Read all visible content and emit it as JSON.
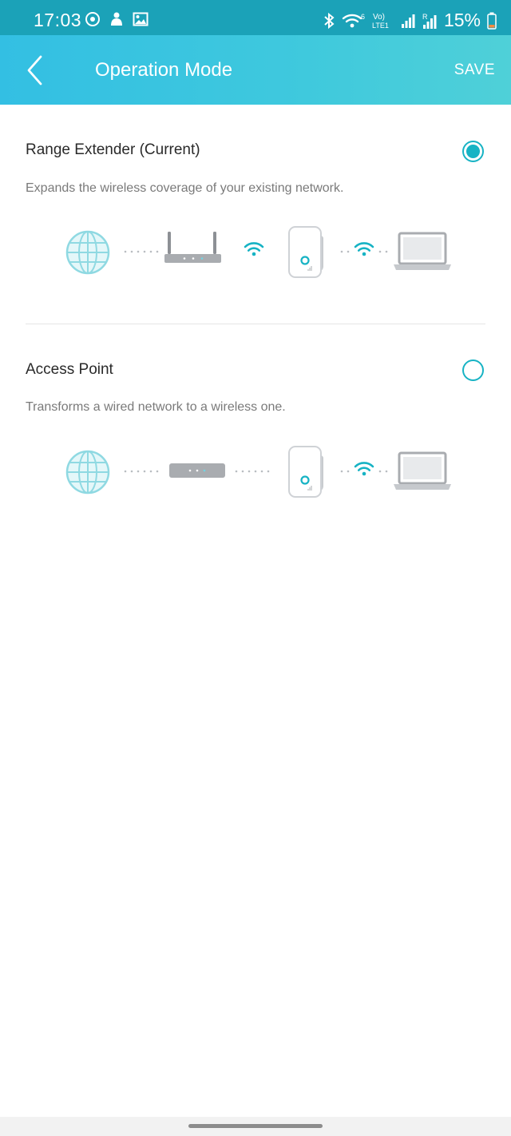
{
  "status_bar": {
    "time": "17:03",
    "battery": "15%",
    "network_type": "LTE1",
    "volte_label": "Vo)",
    "wifi_badge": "6",
    "roaming_badge": "R",
    "icons": [
      "location-sync-icon",
      "person-icon",
      "image-icon",
      "bluetooth-icon",
      "wifi-icon",
      "signal-icon",
      "battery-icon"
    ]
  },
  "header": {
    "title": "Operation Mode",
    "save_label": "SAVE",
    "back_icon": "back-arrow-icon"
  },
  "options": [
    {
      "title": "Range Extender (Current)",
      "description": "Expands the wireless coverage of your existing network.",
      "selected": true,
      "diagram": [
        "globe-icon",
        "router-icon",
        "wifi-icon",
        "extender-icon",
        "wifi-icon",
        "laptop-icon"
      ]
    },
    {
      "title": "Access Point",
      "description": "Transforms a wired network to a wireless one.",
      "selected": false,
      "diagram": [
        "globe-icon",
        "modem-icon",
        "extender-icon",
        "wifi-icon",
        "laptop-icon"
      ]
    }
  ],
  "colors": {
    "accent": "#17b3c4",
    "header_start": "#33bfe3",
    "header_end": "#4fd0d8",
    "status_bar": "#1ba2b8",
    "globe": "#8fd9e2",
    "device_gray": "#a9acb0"
  }
}
